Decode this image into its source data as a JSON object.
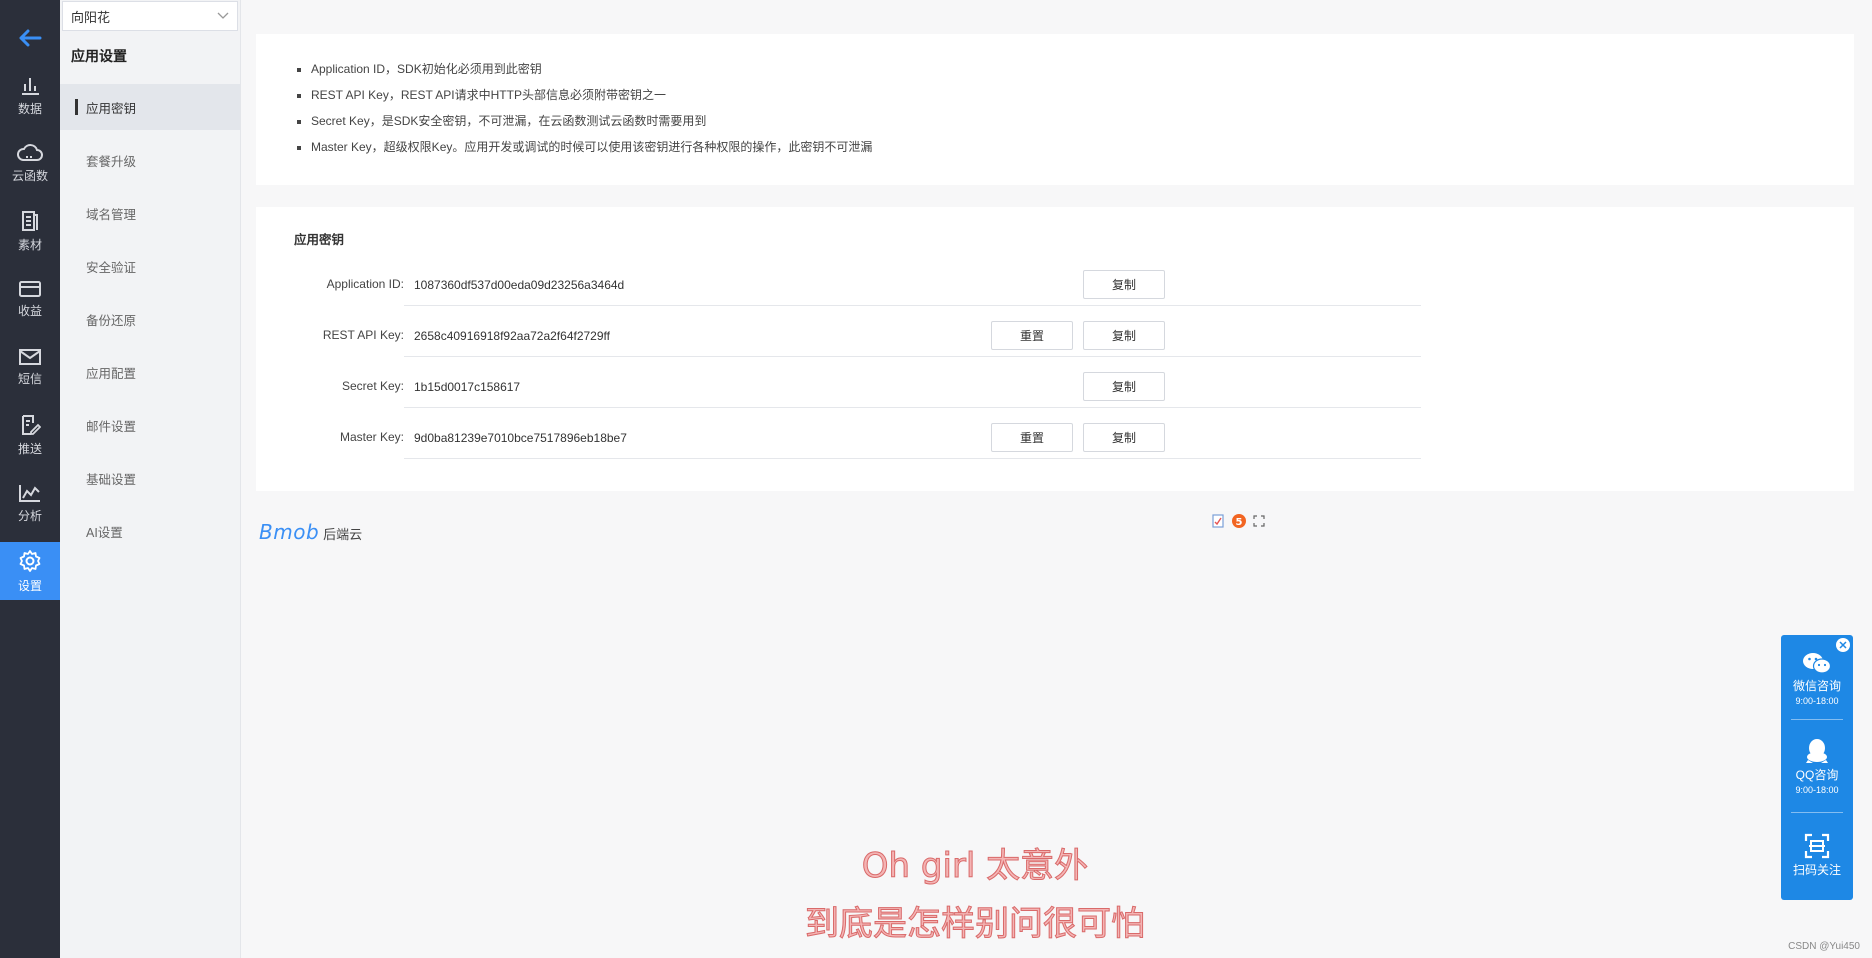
{
  "rail": {
    "items": [
      {
        "label": "数据",
        "icon": "bar-chart-icon"
      },
      {
        "label": "云函数",
        "icon": "cloud-icon"
      },
      {
        "label": "素材",
        "icon": "document-icon"
      },
      {
        "label": "收益",
        "icon": "card-icon"
      },
      {
        "label": "短信",
        "icon": "mail-icon"
      },
      {
        "label": "推送",
        "icon": "edit-icon"
      },
      {
        "label": "分析",
        "icon": "line-chart-icon"
      },
      {
        "label": "设置",
        "icon": "gear-icon"
      }
    ],
    "active_color": "#3a8ff5"
  },
  "sidebar": {
    "app_select_value": "向阳花",
    "title": "应用设置",
    "items": [
      {
        "label": "应用密钥"
      },
      {
        "label": "套餐升级"
      },
      {
        "label": "域名管理"
      },
      {
        "label": "安全验证"
      },
      {
        "label": "备份还原"
      },
      {
        "label": "应用配置"
      },
      {
        "label": "邮件设置"
      },
      {
        "label": "基础设置"
      },
      {
        "label": "AI设置"
      }
    ]
  },
  "notes": [
    "Application ID，SDK初始化必须用到此密钥",
    "REST API Key，REST API请求中HTTP头部信息必须附带密钥之一",
    "Secret Key，是SDK安全密钥，不可泄漏，在云函数测试云函数时需要用到",
    "Master Key，超级权限Key。应用开发或调试的时候可以使用该密钥进行各种权限的操作，此密钥不可泄漏"
  ],
  "keys": {
    "title": "应用密钥",
    "reset_label": "重置",
    "copy_label": "复制",
    "rows": [
      {
        "label": "Application ID:",
        "value": "1087360df537d00eda09d23256a3464d"
      },
      {
        "label": "REST API Key:",
        "value": "2658c40916918f92aa72a2f64f2729ff"
      },
      {
        "label": "Secret Key:",
        "value": "1b15d0017c158617"
      },
      {
        "label": "Master Key:",
        "value": "9d0ba81239e7010bce7517896eb18be7"
      }
    ]
  },
  "brand": {
    "logo": "Bmob",
    "sub": "后端云"
  },
  "float_panel": {
    "wechat_label": "微信咨询",
    "wechat_hours": "9:00-18:00",
    "qq_label": "QQ咨询",
    "qq_hours": "9:00-18:00",
    "scan_label": "扫码关注"
  },
  "subtitles": [
    "Oh girl 太意外",
    "到底是怎样别问很可怕"
  ],
  "watermark": "CSDN @Yui450"
}
